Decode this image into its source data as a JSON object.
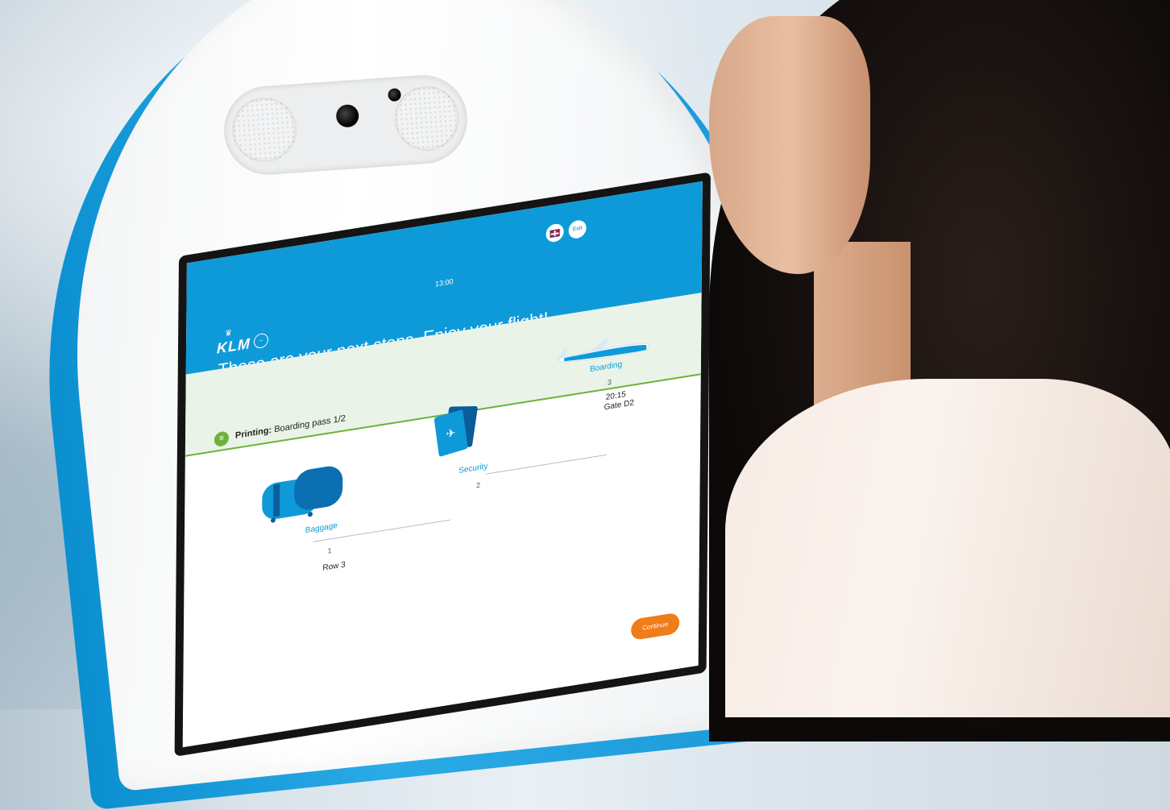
{
  "screen": {
    "time": "13:00",
    "language_button": "English flag",
    "exit_label": "Exit",
    "brand": "KLM",
    "headline": "These are your next steps. Enjoy your flight!",
    "status": {
      "prefix": "Printing:",
      "text": "Boarding pass 1/2"
    },
    "steps": [
      {
        "label": "Baggage",
        "number": "1",
        "detail": "Row 3"
      },
      {
        "label": "Security",
        "number": "2",
        "detail": ""
      },
      {
        "label": "Boarding",
        "number": "3",
        "detail_time": "20:15",
        "detail_gate": "Gate D2"
      }
    ],
    "continue_label": "Continue"
  },
  "colors": {
    "klm_blue": "#0e9ad9",
    "status_green": "#6cb23a",
    "continue_orange": "#f07c1a"
  },
  "icons": [
    "speaker-icon",
    "camera-icon",
    "flag-icon",
    "swirl-icon",
    "luggage-icon",
    "passport-icon",
    "airplane-icon",
    "printer-icon"
  ]
}
